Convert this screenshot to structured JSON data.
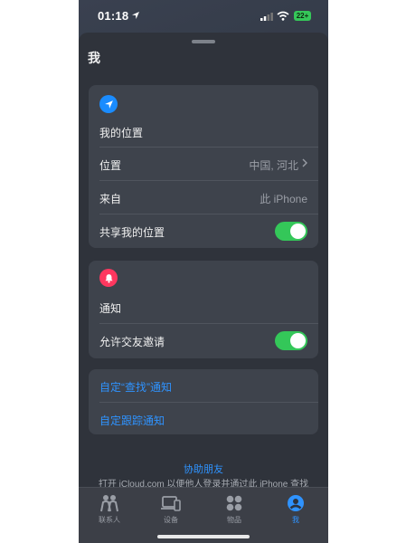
{
  "status": {
    "time": "01:18",
    "battery": "22+"
  },
  "sheet": {
    "title": "我"
  },
  "location_card": {
    "heading": "我的位置",
    "rows": [
      {
        "label": "位置",
        "value": "中国, 河北"
      },
      {
        "label": "来自",
        "value": "此 iPhone"
      },
      {
        "label": "共享我的位置",
        "toggle": true
      }
    ]
  },
  "notify_card": {
    "heading": "通知",
    "allow_label": "允许交友邀请",
    "allow_on": true
  },
  "custom_card": {
    "find_notify": "自定“查找”通知",
    "tracking_notify": "自定跟踪通知"
  },
  "help": {
    "link": "协助朋友",
    "text": "打开 iCloud.com 以便他人登录并通过此 iPhone 查找"
  },
  "tabs": [
    {
      "label": "联系人",
      "icon": "people-icon"
    },
    {
      "label": "设备",
      "icon": "devices-icon"
    },
    {
      "label": "物品",
      "icon": "items-icon"
    },
    {
      "label": "我",
      "icon": "me-icon",
      "active": true
    }
  ],
  "colors": {
    "accent": "#2f93ff",
    "toggle_on": "#34c759",
    "notify_red": "#ff375f"
  }
}
